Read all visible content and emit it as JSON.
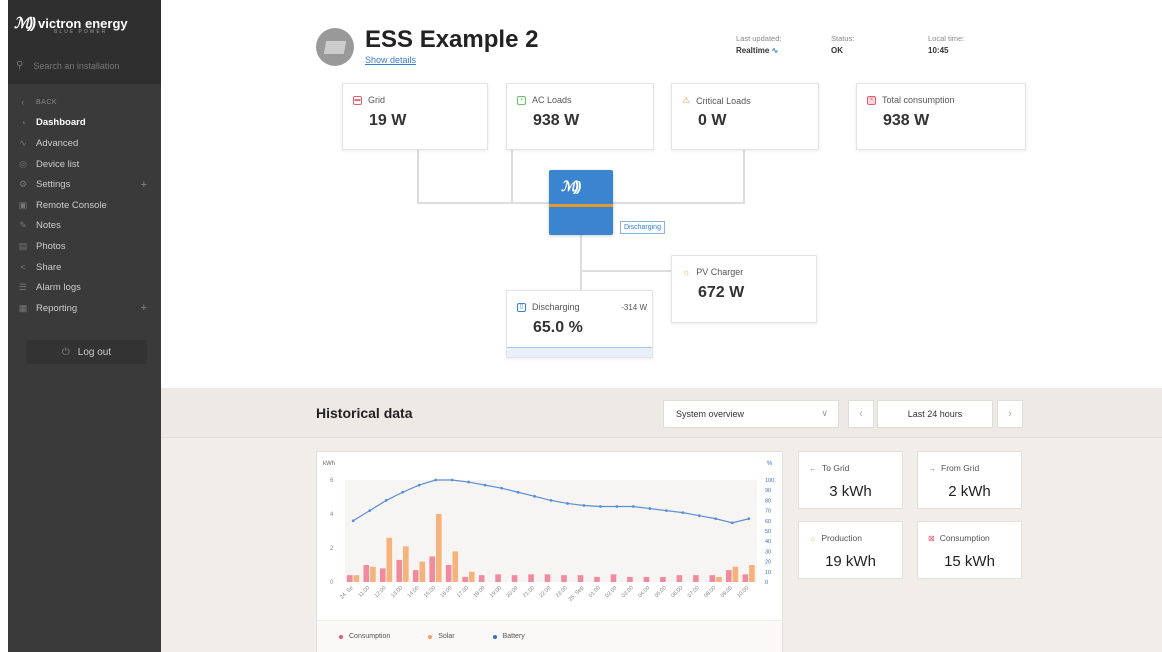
{
  "brand": {
    "name": "victron energy",
    "tagline": "BLUE POWER"
  },
  "search": {
    "placeholder": "Search an installation"
  },
  "nav": {
    "back": "BACK",
    "items": [
      {
        "label": "Dashboard",
        "icon": "gauge-icon",
        "active": true
      },
      {
        "label": "Advanced",
        "icon": "chart-icon"
      },
      {
        "label": "Device list",
        "icon": "location-icon"
      },
      {
        "label": "Settings",
        "icon": "gear-icon",
        "expandable": true
      },
      {
        "label": "Remote Console",
        "icon": "console-icon"
      },
      {
        "label": "Notes",
        "icon": "note-icon"
      },
      {
        "label": "Photos",
        "icon": "photo-icon"
      },
      {
        "label": "Share",
        "icon": "share-icon"
      },
      {
        "label": "Alarm logs",
        "icon": "alarm-icon"
      },
      {
        "label": "Reporting",
        "icon": "report-icon",
        "expandable": true
      }
    ],
    "logout": "Log out"
  },
  "header": {
    "title": "ESS Example 2",
    "show_details": "Show details",
    "last_updated_label": "Last updated:",
    "last_updated_value": "Realtime",
    "status_label": "Status:",
    "status_value": "OK",
    "local_time_label": "Local time:",
    "local_time_value": "10:45"
  },
  "cards": {
    "grid": {
      "label": "Grid",
      "value": "19 W"
    },
    "ac_loads": {
      "label": "AC Loads",
      "value": "938 W"
    },
    "critical_loads": {
      "label": "Critical Loads",
      "value": "0 W"
    },
    "total_consumption": {
      "label": "Total consumption",
      "value": "938 W"
    },
    "pv_charger": {
      "label": "PV Charger",
      "value": "672 W"
    },
    "battery": {
      "label": "Discharging",
      "power": "-314 W",
      "value": "65.0 %"
    }
  },
  "inverter": {
    "state": "Discharging"
  },
  "historical": {
    "title": "Historical data",
    "view": "System overview",
    "range": "Last 24 hours"
  },
  "stats": {
    "to_grid": {
      "label": "To Grid",
      "value": "3 kWh"
    },
    "from_grid": {
      "label": "From Grid",
      "value": "2 kWh"
    },
    "production": {
      "label": "Production",
      "value": "19 kWh"
    },
    "consumption": {
      "label": "Consumption",
      "value": "15 kWh"
    }
  },
  "colors": {
    "consumption": "#f08a9c",
    "solar": "#f5b27a",
    "battery": "#5b8fd6",
    "accent": "#3a84d0"
  },
  "chart_data": {
    "type": "bar",
    "ylabel": "kWh",
    "y2label": "%",
    "ylim": [
      0,
      6
    ],
    "y2lim": [
      0,
      100
    ],
    "yticks": [
      0,
      2,
      4,
      6
    ],
    "y2ticks": [
      0,
      10,
      20,
      30,
      40,
      50,
      60,
      70,
      80,
      90,
      100
    ],
    "categories": [
      "24. Se",
      "11:00",
      "12:00",
      "13:00",
      "14:00",
      "15:00",
      "16:00",
      "17:00",
      "18:00",
      "19:00",
      "20:00",
      "21:00",
      "22:00",
      "23:00",
      "25. Sep",
      "01:00",
      "02:00",
      "03:00",
      "04:00",
      "05:00",
      "06:00",
      "07:00",
      "08:00",
      "09:00",
      "10:00"
    ],
    "series": [
      {
        "name": "Consumption",
        "values": [
          0.4,
          1.0,
          0.8,
          1.3,
          0.7,
          1.5,
          1.0,
          0.3,
          0.4,
          0.45,
          0.4,
          0.45,
          0.45,
          0.4,
          0.4,
          0.3,
          0.45,
          0.3,
          0.3,
          0.3,
          0.4,
          0.4,
          0.4,
          0.7,
          0.45
        ]
      },
      {
        "name": "Solar",
        "values": [
          0.4,
          0.9,
          2.6,
          2.1,
          1.2,
          4.0,
          1.8,
          0.6,
          0,
          0,
          0,
          0,
          0,
          0,
          0,
          0,
          0,
          0,
          0,
          0,
          0,
          0,
          0.3,
          0.9,
          1.0
        ]
      },
      {
        "name": "Battery",
        "values": [
          60,
          70,
          80,
          88,
          95,
          100,
          100,
          98,
          95,
          92,
          88,
          84,
          80,
          77,
          75,
          74,
          74,
          74,
          72,
          70,
          68,
          65,
          62,
          58,
          62
        ]
      }
    ]
  }
}
